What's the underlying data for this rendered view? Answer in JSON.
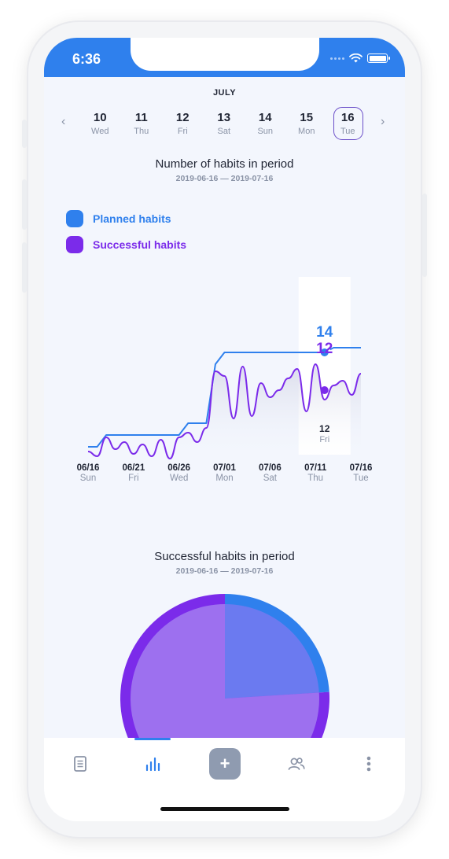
{
  "status_bar": {
    "time": "6:36"
  },
  "calendar": {
    "month": "JULY",
    "prev_arrow": "‹",
    "next_arrow": "›",
    "days": [
      {
        "num": "10",
        "dow": "Wed"
      },
      {
        "num": "11",
        "dow": "Thu"
      },
      {
        "num": "12",
        "dow": "Fri"
      },
      {
        "num": "13",
        "dow": "Sat"
      },
      {
        "num": "14",
        "dow": "Sun"
      },
      {
        "num": "15",
        "dow": "Mon"
      },
      {
        "num": "16",
        "dow": "Tue"
      }
    ],
    "selected_index": 6
  },
  "habits_chart": {
    "title": "Number of habits in period",
    "range": "2019-06-16 — 2019-07-16",
    "legend": [
      {
        "label": "Planned habits",
        "color": "#2f80ed"
      },
      {
        "label": "Successful habits",
        "color": "#7b2bea"
      }
    ]
  },
  "chart_data": {
    "type": "line",
    "x": [
      "06/16",
      "06/17",
      "06/18",
      "06/19",
      "06/20",
      "06/21",
      "06/22",
      "06/23",
      "06/24",
      "06/25",
      "06/26",
      "06/27",
      "06/28",
      "06/29",
      "06/30",
      "07/01",
      "07/02",
      "07/03",
      "07/04",
      "07/05",
      "07/06",
      "07/07",
      "07/08",
      "07/09",
      "07/10",
      "07/11",
      "07/12",
      "07/13",
      "07/14",
      "07/15",
      "07/16"
    ],
    "x_tick_labels": [
      {
        "date": "06/16",
        "dow": "Sun"
      },
      {
        "date": "06/21",
        "dow": "Fri"
      },
      {
        "date": "06/26",
        "dow": "Wed"
      },
      {
        "date": "07/01",
        "dow": "Mon"
      },
      {
        "date": "07/06",
        "dow": "Sat"
      },
      {
        "date": "07/11",
        "dow": "Thu"
      },
      {
        "date": "07/16",
        "dow": "Tue"
      }
    ],
    "series": [
      {
        "name": "Planned habits",
        "color": "#2f80ed",
        "values": [
          10,
          10,
          10.5,
          10.5,
          10.5,
          10.5,
          10.5,
          10.5,
          10.5,
          10.5,
          10.5,
          11,
          11,
          11,
          13.5,
          14,
          14,
          14,
          14,
          14,
          14,
          14,
          14,
          14,
          14,
          14,
          14,
          14.2,
          14.2,
          14.2,
          14.2
        ]
      },
      {
        "name": "Successful habits",
        "color": "#7b2bea",
        "values": [
          9.8,
          9.6,
          10.4,
          9.9,
          10.2,
          9.7,
          10.1,
          9.6,
          10.3,
          9.5,
          10.4,
          10.6,
          10.2,
          10.8,
          13.2,
          13,
          11.2,
          13.4,
          11.3,
          12.7,
          12.1,
          12.4,
          12.9,
          13.3,
          11.5,
          13.5,
          12,
          12.6,
          12.8,
          12.2,
          13.1
        ]
      }
    ],
    "ylim": [
      8,
      16
    ],
    "tooltip": {
      "index": 26,
      "planned": "14",
      "successful": "12",
      "date": "12",
      "dow": "Fri"
    }
  },
  "pie_chart": {
    "title": "Successful habits in period",
    "range": "2019-06-16 — 2019-07-16"
  },
  "pie_data": {
    "type": "pie",
    "slices": [
      {
        "name": "Planned habits",
        "value": 0.24,
        "color": "#2f80ed"
      },
      {
        "name": "Successful habits",
        "value": 0.76,
        "color": "#7b2bea"
      }
    ]
  },
  "tab_bar": {
    "tabs": [
      {
        "icon": "document-icon"
      },
      {
        "icon": "bar-chart-icon"
      },
      {
        "icon": "plus-icon",
        "label": "+"
      },
      {
        "icon": "users-icon"
      },
      {
        "icon": "more-vertical-icon"
      }
    ],
    "active_index": 1
  }
}
